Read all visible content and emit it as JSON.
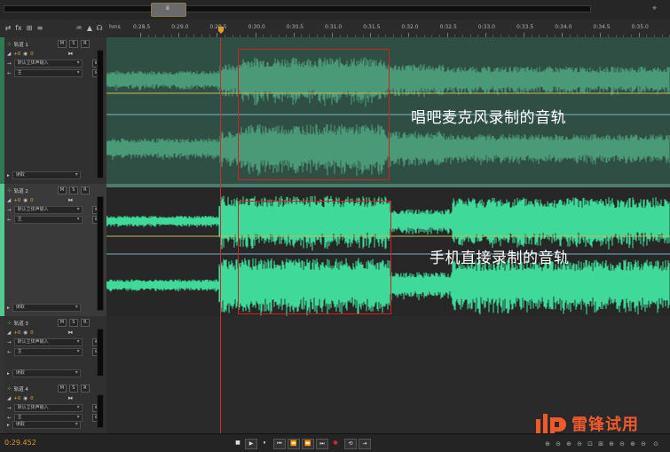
{
  "overview": {
    "thumb_label": "ⅲ"
  },
  "toolbar": {
    "icons": [
      "swap-icon",
      "fx-icon",
      "tracks-icon",
      "sends-icon",
      "eq-icon",
      "headphones-icon"
    ]
  },
  "ruler": {
    "unit": "hms",
    "labels": [
      "0:28.5",
      "0:29.0",
      "0:29.5",
      "0:30.0",
      "0:30.5",
      "0:31.0",
      "0:31.5",
      "0:32.0",
      "0:32.5",
      "0:33.0",
      "0:33.5",
      "0:34.0",
      "0:34.5",
      "0:35.0"
    ]
  },
  "tracks": [
    {
      "name": "轨道 1",
      "volume": "+0",
      "pan": "0",
      "input": "默认立体声输入",
      "output": "主",
      "read": "读取",
      "mute": "M",
      "solo": "S",
      "record": "R"
    },
    {
      "name": "轨道 2",
      "volume": "+0",
      "pan": "0",
      "input": "默认立体声输入",
      "output": "主",
      "read": "读取",
      "mute": "M",
      "solo": "S",
      "record": "R"
    },
    {
      "name": "轨道 3",
      "volume": "+0",
      "pan": "0",
      "input": "默认立体声输入",
      "output": "主",
      "read": "读取",
      "mute": "M",
      "solo": "S",
      "record": "R"
    },
    {
      "name": "轨道 4",
      "volume": "+0",
      "pan": "0",
      "input": "默认立体声输入",
      "output": "主",
      "read": "读取",
      "mute": "M",
      "solo": "S",
      "record": "R"
    }
  ],
  "annotations": {
    "track1": "唱吧麦克风录制的音轨",
    "track2": "手机直接录制的音轨"
  },
  "transport": {
    "time": "0:29.452",
    "buttons": [
      "■",
      "▶",
      "⏸",
      "⏮",
      "⏪",
      "⏩",
      "⏭",
      "●",
      "⟲",
      "⇥"
    ]
  },
  "watermark": {
    "text": "雷锋试用"
  },
  "colors": {
    "waveform_dim": "#4a9a78",
    "waveform_bright": "#3fd99a",
    "accent": "#e0a020",
    "selection": "#d02020"
  }
}
